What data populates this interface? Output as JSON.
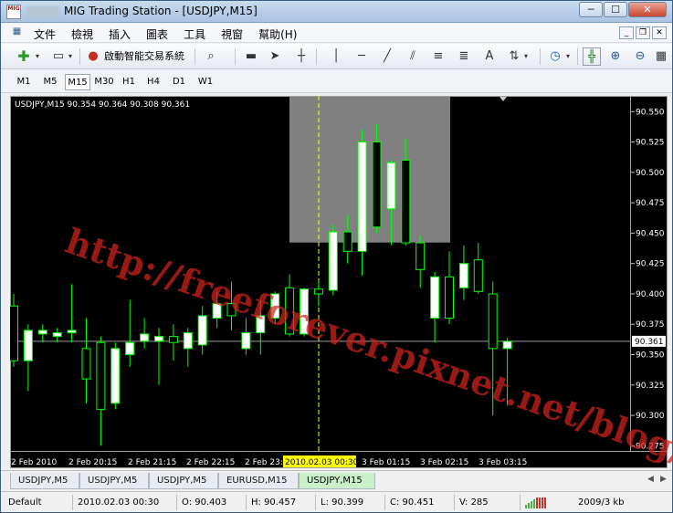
{
  "window": {
    "title": "MIG Trading Station - [USDJPY,M15]",
    "app_icon": "MIG",
    "minimize": "─",
    "maximize": "☐",
    "close": "✕"
  },
  "menu": {
    "items": [
      "文件",
      "檢視",
      "插入",
      "圖表",
      "工具",
      "視窗",
      "幫助(H)"
    ],
    "mdi_minimize": "_",
    "mdi_restore": "❐",
    "mdi_close": "✕"
  },
  "toolbar": {
    "expert_label": "啟動智能交易系統",
    "text_tool": "A"
  },
  "timeframes": [
    "M1",
    "M5",
    "M15",
    "M30",
    "H1",
    "H4",
    "D1",
    "W1"
  ],
  "active_timeframe": "M15",
  "chart_header": "USDJPY,M15  90.354 90.364 90.308 90.361",
  "chart_data": {
    "type": "candlestick",
    "symbol": "USDJPY",
    "timeframe": "M15",
    "ylim": [
      90.27,
      90.563
    ],
    "price_ticks": [
      "90.550",
      "90.525",
      "90.500",
      "90.475",
      "90.450",
      "90.425",
      "90.400",
      "90.375",
      "90.350",
      "90.325",
      "90.300",
      "90.275"
    ],
    "current_price": "90.361",
    "time_labels": [
      "2 Feb 2010",
      "2 Feb 20:15",
      "2 Feb 21:15",
      "2 Feb 22:15",
      "2 Feb 23:15",
      "3 Feb 00:30",
      "3 Feb 01:15",
      "3 Feb 02:15",
      "3 Feb 03:15"
    ],
    "crosshair_time": "2010.02.03 00:30",
    "candles": [
      {
        "o": 90.39,
        "h": 90.4,
        "l": 90.34,
        "c": 90.345
      },
      {
        "o": 90.345,
        "h": 90.375,
        "l": 90.32,
        "c": 90.37
      },
      {
        "o": 90.367,
        "h": 90.375,
        "l": 90.36,
        "c": 90.37
      },
      {
        "o": 90.365,
        "h": 90.372,
        "l": 90.36,
        "c": 90.368
      },
      {
        "o": 90.368,
        "h": 90.408,
        "l": 90.36,
        "c": 90.37
      },
      {
        "o": 90.355,
        "h": 90.38,
        "l": 90.31,
        "c": 90.33
      },
      {
        "o": 90.36,
        "h": 90.365,
        "l": 90.275,
        "c": 90.305
      },
      {
        "o": 90.31,
        "h": 90.36,
        "l": 90.305,
        "c": 90.355
      },
      {
        "o": 90.35,
        "h": 90.395,
        "l": 90.34,
        "c": 90.36
      },
      {
        "o": 90.361,
        "h": 90.38,
        "l": 90.355,
        "c": 90.367
      },
      {
        "o": 90.361,
        "h": 90.372,
        "l": 90.325,
        "c": 90.365
      },
      {
        "o": 90.365,
        "h": 90.375,
        "l": 90.345,
        "c": 90.36
      },
      {
        "o": 90.355,
        "h": 90.372,
        "l": 90.34,
        "c": 90.368
      },
      {
        "o": 90.358,
        "h": 90.39,
        "l": 90.35,
        "c": 90.382
      },
      {
        "o": 90.38,
        "h": 90.402,
        "l": 90.372,
        "c": 90.392
      },
      {
        "o": 90.392,
        "h": 90.41,
        "l": 90.37,
        "c": 90.382
      },
      {
        "o": 90.355,
        "h": 90.38,
        "l": 90.35,
        "c": 90.368
      },
      {
        "o": 90.368,
        "h": 90.395,
        "l": 90.35,
        "c": 90.382
      },
      {
        "o": 90.38,
        "h": 90.402,
        "l": 90.375,
        "c": 90.4
      },
      {
        "o": 90.405,
        "h": 90.416,
        "l": 90.365,
        "c": 90.367
      },
      {
        "o": 90.367,
        "h": 90.405,
        "l": 90.365,
        "c": 90.404
      },
      {
        "o": 90.404,
        "h": 90.411,
        "l": 90.39,
        "c": 90.4
      },
      {
        "o": 90.403,
        "h": 90.457,
        "l": 90.399,
        "c": 90.451
      },
      {
        "o": 90.451,
        "h": 90.465,
        "l": 90.425,
        "c": 90.435
      },
      {
        "o": 90.435,
        "h": 90.535,
        "l": 90.415,
        "c": 90.525
      },
      {
        "o": 90.525,
        "h": 90.54,
        "l": 90.45,
        "c": 90.455
      },
      {
        "o": 90.47,
        "h": 90.51,
        "l": 90.44,
        "c": 90.508
      },
      {
        "o": 90.51,
        "h": 90.528,
        "l": 90.44,
        "c": 90.442
      },
      {
        "o": 90.442,
        "h": 90.448,
        "l": 90.405,
        "c": 90.42
      },
      {
        "o": 90.38,
        "h": 90.418,
        "l": 90.36,
        "c": 90.414
      },
      {
        "o": 90.414,
        "h": 90.435,
        "l": 90.375,
        "c": 90.38
      },
      {
        "o": 90.405,
        "h": 90.44,
        "l": 90.395,
        "c": 90.425
      },
      {
        "o": 90.428,
        "h": 90.442,
        "l": 90.4,
        "c": 90.402
      },
      {
        "o": 90.4,
        "h": 90.41,
        "l": 90.3,
        "c": 90.355
      },
      {
        "o": 90.355,
        "h": 90.364,
        "l": 90.308,
        "c": 90.361
      }
    ]
  },
  "tabs": [
    "USDJPY,M5",
    "USDJPY,M5",
    "USDJPY,M5",
    "EURUSD,M15",
    "USDJPY,M15"
  ],
  "active_tab": "USDJPY,M15",
  "status": {
    "profile": "Default",
    "time": "2010.02.03 00:30",
    "open": "O: 90.403",
    "high": "H: 90.457",
    "low": "L: 90.399",
    "close": "C: 90.451",
    "volume": "V: 285",
    "traffic": "2009/3 kb"
  },
  "watermark": "http://freeforever.pixnet.net/blog/",
  "colors": {
    "bull": "#ffffff",
    "bear": "#000000",
    "wick": "#00ff00",
    "grid_shade": "#808080",
    "crosshair": "#ffff00"
  }
}
